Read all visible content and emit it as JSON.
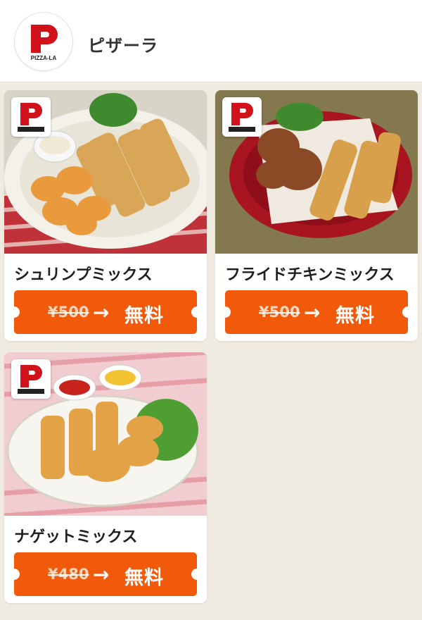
{
  "header": {
    "logo_text": "PIZZA-LA",
    "title": "ピザーラ"
  },
  "colors": {
    "accent": "#f05a0a",
    "brand_red": "#d2121b",
    "background": "#f0ebe1"
  },
  "icons": {
    "arrow": "→",
    "logo": "pizza-la-logo-icon"
  },
  "cards": [
    {
      "title": "シュリンプミックス",
      "price": "¥500",
      "free_label": "無料"
    },
    {
      "title": "フライドチキンミックス",
      "price": "¥500",
      "free_label": "無料"
    },
    {
      "title": "ナゲットミックス",
      "price": "¥480",
      "free_label": "無料"
    }
  ]
}
